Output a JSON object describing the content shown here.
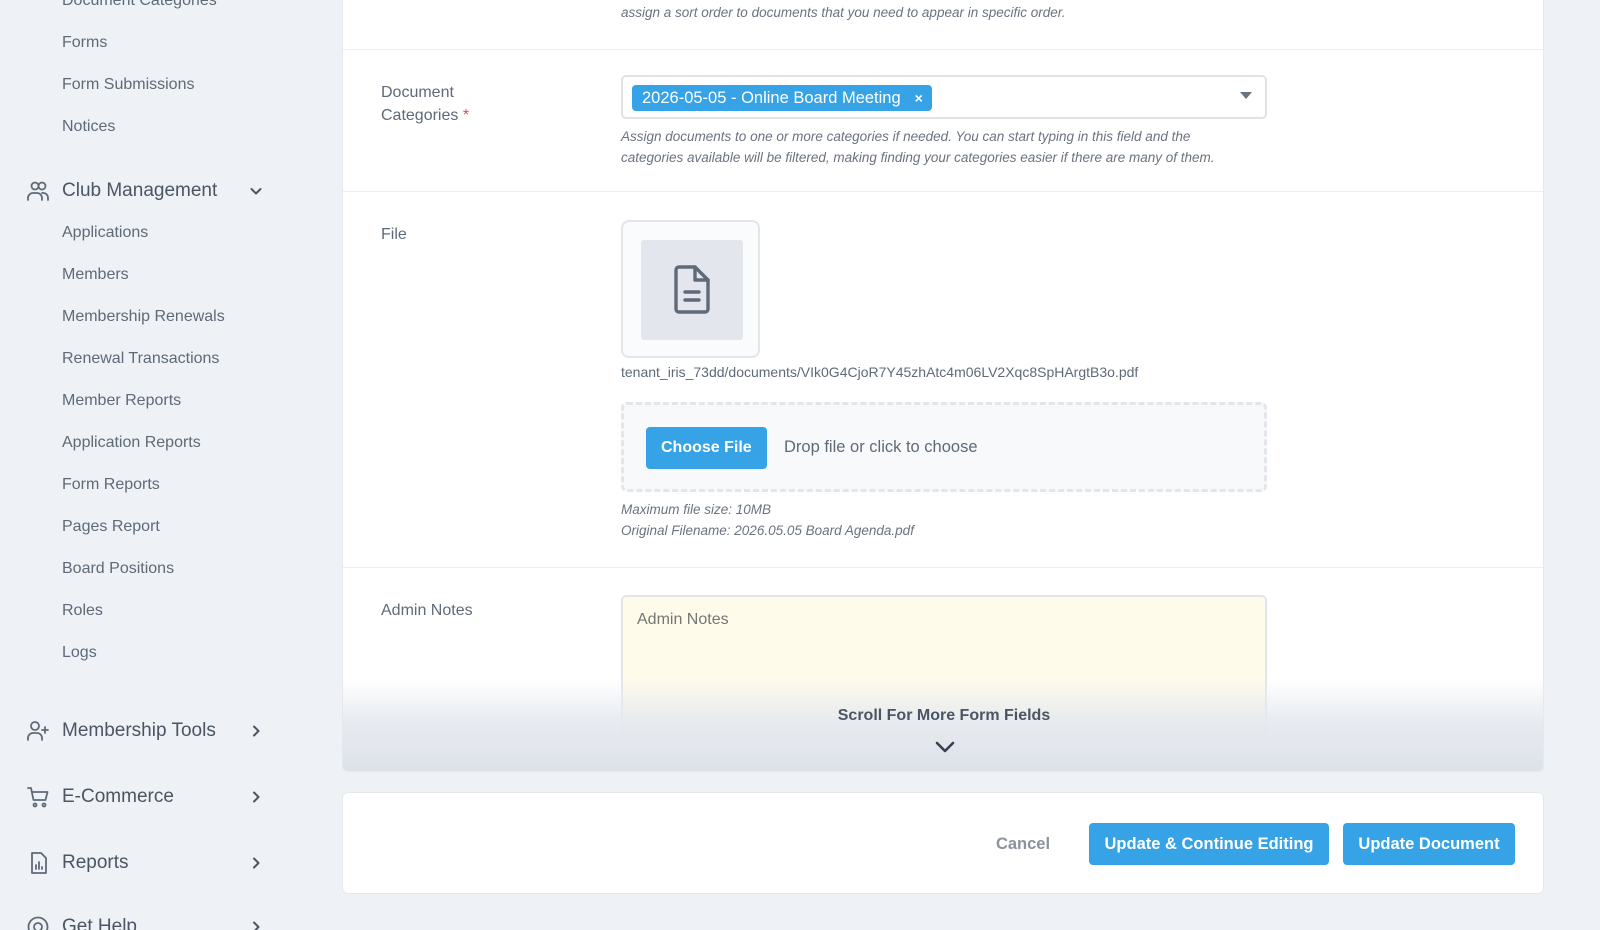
{
  "sidebar": {
    "document_items": [
      "Document Categories",
      "Forms",
      "Form Submissions",
      "Notices"
    ],
    "club_management": {
      "label": "Club Management",
      "items": [
        "Applications",
        "Members",
        "Membership Renewals",
        "Renewal Transactions",
        "Member Reports",
        "Application Reports",
        "Form Reports",
        "Pages Report",
        "Board Positions",
        "Roles",
        "Logs"
      ]
    },
    "membership_tools": {
      "label": "Membership Tools"
    },
    "ecommerce": {
      "label": "E-Commerce"
    },
    "reports": {
      "label": "Reports"
    },
    "get_help": {
      "label": "Get Help"
    }
  },
  "form": {
    "sort_help": "assign a sort order to documents that you need to appear in specific order.",
    "categories": {
      "label_line1": "Document",
      "label_line2": "Categories",
      "required_mark": "*",
      "selected": "2026-05-05 - Online Board Meeting",
      "remove": "×",
      "help_line1": "Assign documents to one or more categories if needed. You can start typing in this field and the",
      "help_line2": "categories available will be filtered, making finding your categories easier if there are many of them."
    },
    "file": {
      "label": "File",
      "path": "tenant_iris_73dd/documents/VIk0G4CjoR7Y45zhAtc4m06LV2Xqc8SpHArgtB3o.pdf",
      "choose_label": "Choose File",
      "drop_text": "Drop file or click to choose",
      "max_size": "Maximum file size: 10MB",
      "original_filename": "Original Filename: 2026.05.05 Board Agenda.pdf"
    },
    "admin_notes": {
      "label": "Admin Notes",
      "placeholder": "Admin Notes"
    },
    "scroll_hint": "Scroll For More Form Fields"
  },
  "footer": {
    "cancel": "Cancel",
    "update_continue": "Update & Continue Editing",
    "update": "Update Document"
  },
  "colors": {
    "primary": "#36a3e6",
    "required": "#e04b4b",
    "notes_bg": "#fefbea"
  }
}
